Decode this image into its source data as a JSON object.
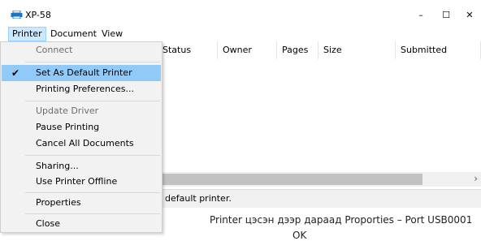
{
  "window": {
    "title": "XP-58",
    "controls": {
      "minimize": "–",
      "maximize": "☐",
      "close": "✕"
    }
  },
  "menubar": {
    "items": [
      "Printer",
      "Document",
      "View"
    ]
  },
  "columns": [
    "Status",
    "Owner",
    "Pages",
    "Size",
    "Submitted"
  ],
  "dropdown": {
    "connect": "Connect",
    "set_default": "Set As Default Printer",
    "printing_prefs": "Printing Preferences...",
    "update_driver": "Update Driver",
    "pause_printing": "Pause Printing",
    "cancel_all": "Cancel All Documents",
    "sharing": "Sharing...",
    "use_offline": "Use Printer Offline",
    "properties": "Properties",
    "close": "Close"
  },
  "icons": {
    "check": "check-icon",
    "scroll_right": "chevron-right-icon"
  },
  "status_text": "default printer.",
  "caption": {
    "line1": "Printer цэсэн дээр дараад  Proporties – Port USB0001",
    "line2": "OK"
  },
  "colors": {
    "highlight": "#91c9f7",
    "menu_open": "#cce8ff"
  }
}
